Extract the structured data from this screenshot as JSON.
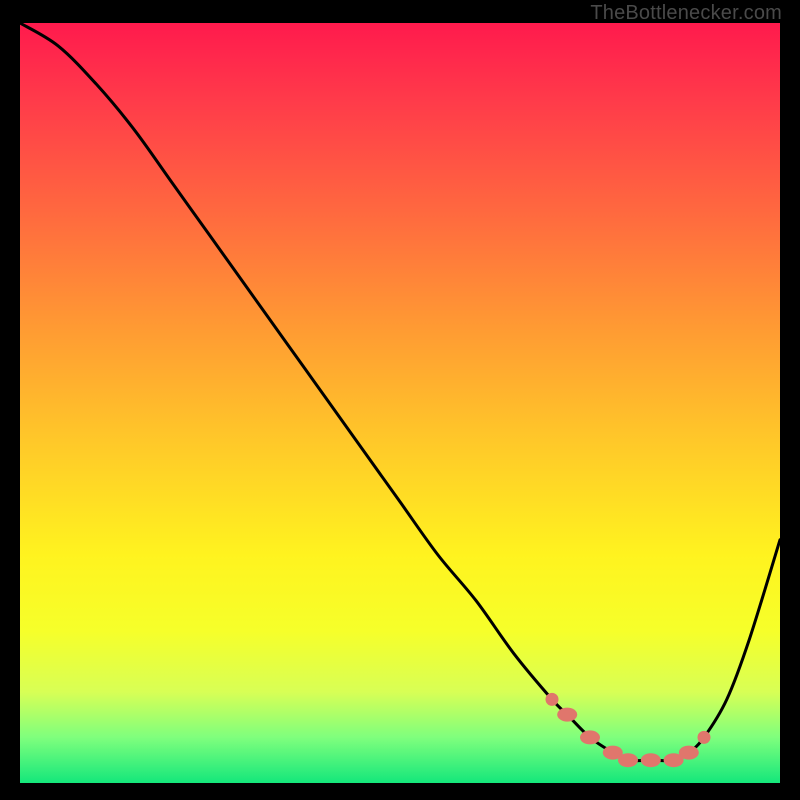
{
  "watermark": "TheBottlenecker.com",
  "colors": {
    "frame": "#000000",
    "curve": "#000000",
    "marker_fill": "#e0766c",
    "marker_stroke": "#c25a50"
  },
  "chart_data": {
    "type": "line",
    "title": "",
    "xlabel": "",
    "ylabel": "",
    "xlim": [
      0,
      100
    ],
    "ylim": [
      0,
      100
    ],
    "series": [
      {
        "name": "bottleneck-curve",
        "x": [
          0,
          5,
          10,
          15,
          20,
          25,
          30,
          35,
          40,
          45,
          50,
          55,
          60,
          65,
          70,
          72,
          75,
          78,
          80,
          83,
          86,
          88,
          90,
          93,
          96,
          100
        ],
        "y": [
          100,
          97,
          92,
          86,
          79,
          72,
          65,
          58,
          51,
          44,
          37,
          30,
          24,
          17,
          11,
          9,
          6,
          4,
          3,
          3,
          3,
          4,
          6,
          11,
          19,
          32
        ]
      }
    ],
    "markers": {
      "name": "highlight-points",
      "x": [
        70,
        72,
        75,
        78,
        80,
        83,
        86,
        88,
        90
      ],
      "y": [
        11,
        9,
        6,
        4,
        3,
        3,
        3,
        4,
        6
      ]
    }
  }
}
